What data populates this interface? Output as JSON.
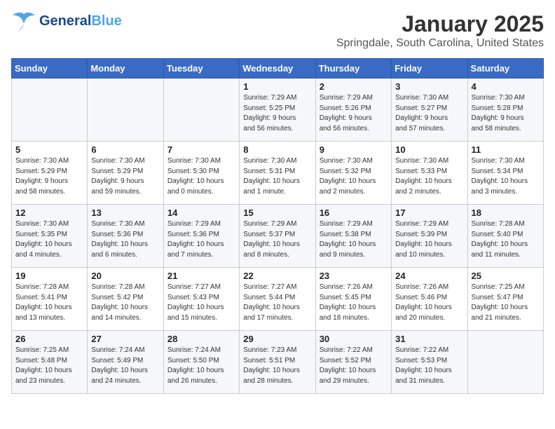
{
  "header": {
    "logo_general": "General",
    "logo_blue": "Blue",
    "title": "January 2025",
    "subtitle": "Springdale, South Carolina, United States"
  },
  "weekdays": [
    "Sunday",
    "Monday",
    "Tuesday",
    "Wednesday",
    "Thursday",
    "Friday",
    "Saturday"
  ],
  "weeks": [
    [
      {
        "day": "",
        "info": ""
      },
      {
        "day": "",
        "info": ""
      },
      {
        "day": "",
        "info": ""
      },
      {
        "day": "1",
        "info": "Sunrise: 7:29 AM\nSunset: 5:25 PM\nDaylight: 9 hours\nand 56 minutes."
      },
      {
        "day": "2",
        "info": "Sunrise: 7:29 AM\nSunset: 5:26 PM\nDaylight: 9 hours\nand 56 minutes."
      },
      {
        "day": "3",
        "info": "Sunrise: 7:30 AM\nSunset: 5:27 PM\nDaylight: 9 hours\nand 57 minutes."
      },
      {
        "day": "4",
        "info": "Sunrise: 7:30 AM\nSunset: 5:28 PM\nDaylight: 9 hours\nand 58 minutes."
      }
    ],
    [
      {
        "day": "5",
        "info": "Sunrise: 7:30 AM\nSunset: 5:29 PM\nDaylight: 9 hours\nand 58 minutes."
      },
      {
        "day": "6",
        "info": "Sunrise: 7:30 AM\nSunset: 5:29 PM\nDaylight: 9 hours\nand 59 minutes."
      },
      {
        "day": "7",
        "info": "Sunrise: 7:30 AM\nSunset: 5:30 PM\nDaylight: 10 hours\nand 0 minutes."
      },
      {
        "day": "8",
        "info": "Sunrise: 7:30 AM\nSunset: 5:31 PM\nDaylight: 10 hours\nand 1 minute."
      },
      {
        "day": "9",
        "info": "Sunrise: 7:30 AM\nSunset: 5:32 PM\nDaylight: 10 hours\nand 2 minutes."
      },
      {
        "day": "10",
        "info": "Sunrise: 7:30 AM\nSunset: 5:33 PM\nDaylight: 10 hours\nand 2 minutes."
      },
      {
        "day": "11",
        "info": "Sunrise: 7:30 AM\nSunset: 5:34 PM\nDaylight: 10 hours\nand 3 minutes."
      }
    ],
    [
      {
        "day": "12",
        "info": "Sunrise: 7:30 AM\nSunset: 5:35 PM\nDaylight: 10 hours\nand 4 minutes."
      },
      {
        "day": "13",
        "info": "Sunrise: 7:30 AM\nSunset: 5:36 PM\nDaylight: 10 hours\nand 6 minutes."
      },
      {
        "day": "14",
        "info": "Sunrise: 7:29 AM\nSunset: 5:36 PM\nDaylight: 10 hours\nand 7 minutes."
      },
      {
        "day": "15",
        "info": "Sunrise: 7:29 AM\nSunset: 5:37 PM\nDaylight: 10 hours\nand 8 minutes."
      },
      {
        "day": "16",
        "info": "Sunrise: 7:29 AM\nSunset: 5:38 PM\nDaylight: 10 hours\nand 9 minutes."
      },
      {
        "day": "17",
        "info": "Sunrise: 7:29 AM\nSunset: 5:39 PM\nDaylight: 10 hours\nand 10 minutes."
      },
      {
        "day": "18",
        "info": "Sunrise: 7:28 AM\nSunset: 5:40 PM\nDaylight: 10 hours\nand 11 minutes."
      }
    ],
    [
      {
        "day": "19",
        "info": "Sunrise: 7:28 AM\nSunset: 5:41 PM\nDaylight: 10 hours\nand 13 minutes."
      },
      {
        "day": "20",
        "info": "Sunrise: 7:28 AM\nSunset: 5:42 PM\nDaylight: 10 hours\nand 14 minutes."
      },
      {
        "day": "21",
        "info": "Sunrise: 7:27 AM\nSunset: 5:43 PM\nDaylight: 10 hours\nand 15 minutes."
      },
      {
        "day": "22",
        "info": "Sunrise: 7:27 AM\nSunset: 5:44 PM\nDaylight: 10 hours\nand 17 minutes."
      },
      {
        "day": "23",
        "info": "Sunrise: 7:26 AM\nSunset: 5:45 PM\nDaylight: 10 hours\nand 18 minutes."
      },
      {
        "day": "24",
        "info": "Sunrise: 7:26 AM\nSunset: 5:46 PM\nDaylight: 10 hours\nand 20 minutes."
      },
      {
        "day": "25",
        "info": "Sunrise: 7:25 AM\nSunset: 5:47 PM\nDaylight: 10 hours\nand 21 minutes."
      }
    ],
    [
      {
        "day": "26",
        "info": "Sunrise: 7:25 AM\nSunset: 5:48 PM\nDaylight: 10 hours\nand 23 minutes."
      },
      {
        "day": "27",
        "info": "Sunrise: 7:24 AM\nSunset: 5:49 PM\nDaylight: 10 hours\nand 24 minutes."
      },
      {
        "day": "28",
        "info": "Sunrise: 7:24 AM\nSunset: 5:50 PM\nDaylight: 10 hours\nand 26 minutes."
      },
      {
        "day": "29",
        "info": "Sunrise: 7:23 AM\nSunset: 5:51 PM\nDaylight: 10 hours\nand 28 minutes."
      },
      {
        "day": "30",
        "info": "Sunrise: 7:22 AM\nSunset: 5:52 PM\nDaylight: 10 hours\nand 29 minutes."
      },
      {
        "day": "31",
        "info": "Sunrise: 7:22 AM\nSunset: 5:53 PM\nDaylight: 10 hours\nand 31 minutes."
      },
      {
        "day": "",
        "info": ""
      }
    ]
  ]
}
